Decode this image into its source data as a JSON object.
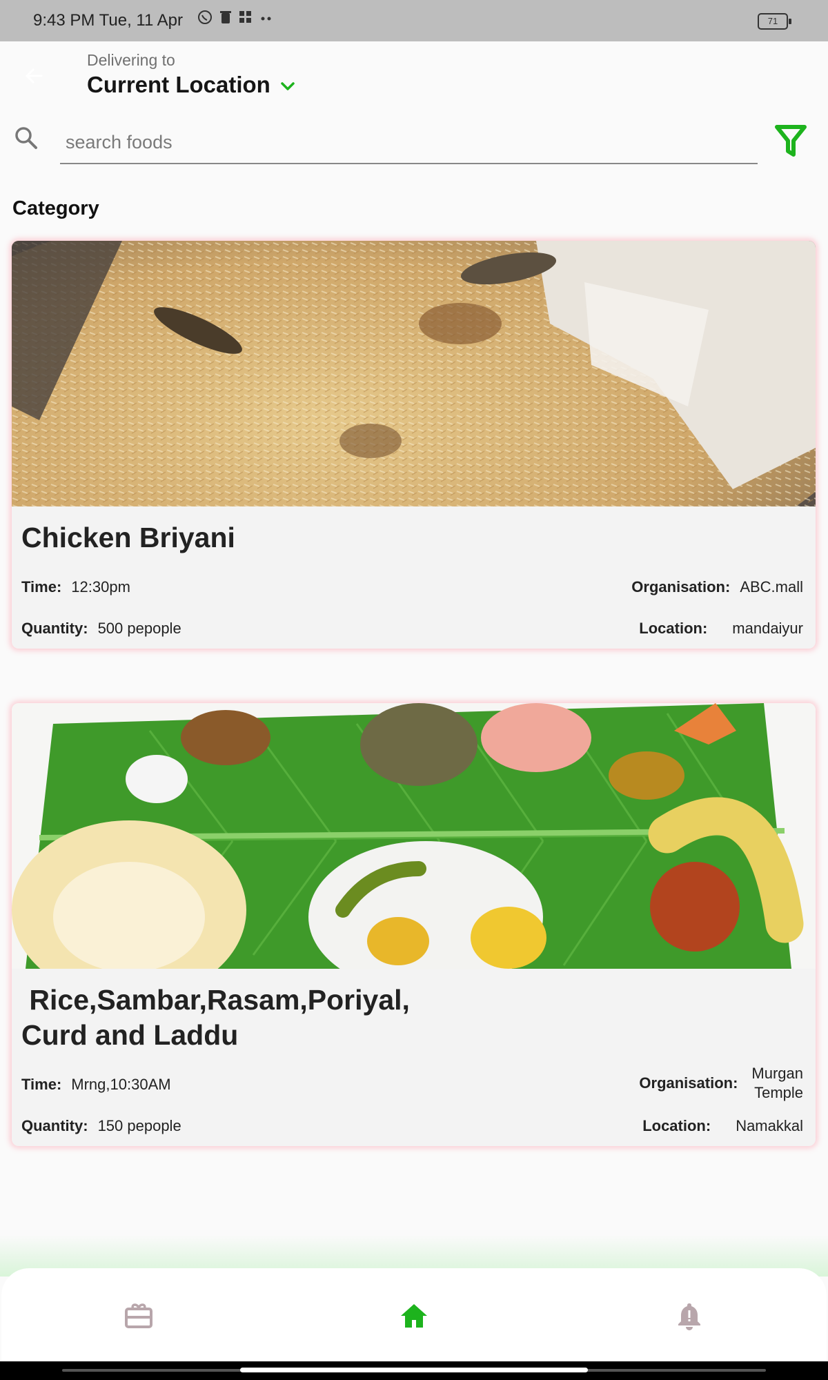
{
  "status_bar": {
    "time": "9:43 PM  Tue, 11 Apr",
    "battery": "71",
    "icons": [
      "whatsapp-icon",
      "trash-icon",
      "apps-icon",
      "more-dots-icon"
    ]
  },
  "header": {
    "delivering_label": "Delivering to",
    "location": "Current Location"
  },
  "search": {
    "placeholder": "search foods"
  },
  "category_heading": "Category",
  "cards": [
    {
      "title": "Chicken Briyani",
      "time_label": "Time:",
      "time": "12:30pm",
      "quantity_label": "Quantity:",
      "quantity": "500 pepople",
      "organisation_label": "Organisation:",
      "organisation": "ABC.mall",
      "location_label": "Location:",
      "location": "mandaiyur"
    },
    {
      "title_line1": " Rice,Sambar,Rasam,Poriyal,",
      "title_line2": "Curd and Laddu",
      "time_label": "Time:",
      "time": "Mrng,10:30AM",
      "quantity_label": "Quantity:",
      "quantity": "150 pepople",
      "organisation_label": "Organisation:",
      "organisation_line1": "Murgan",
      "organisation_line2": "Temple",
      "location_label": "Location:",
      "location": "Namakkal"
    }
  ],
  "bottom_nav": {
    "items": [
      "gift-card-icon",
      "home-icon",
      "notification-alert-icon"
    ],
    "active": "home-icon"
  },
  "colors": {
    "accent": "#1db31d",
    "card_glow": "#ff8fa0",
    "nav_inactive": "#b8a6ab"
  }
}
